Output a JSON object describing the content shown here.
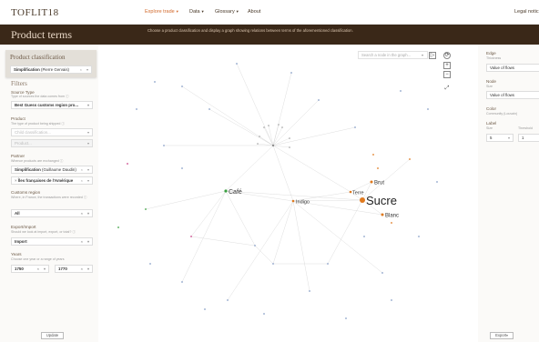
{
  "header": {
    "logo": "TOFLIT18",
    "nav": {
      "explore": "Explore trade",
      "data": "Data",
      "glossary": "Glossary",
      "about": "About",
      "legal": "Legal notic"
    }
  },
  "titlebar": {
    "title": "Product terms",
    "description": "Choose a product classification and display a graph showing relations between terms of the aforementioned classification."
  },
  "left_panel": {
    "product_classification": {
      "title": "Product classification",
      "value_bold": "Simplification",
      "value_rest": " (Pierre Gervais)"
    },
    "filters_title": "Filters",
    "source_type": {
      "label": "Source Type",
      "sub": "Type of sources the data comes from",
      "value": "Best Guess customs region pro..."
    },
    "product": {
      "label": "Product",
      "sub": "The type of product being shipped",
      "placeholder_classification": "Child classification...",
      "placeholder_product": "Product..."
    },
    "partner": {
      "label": "Partner",
      "sub": "Whence products are exchanged",
      "value_bold": "Simplification",
      "value_rest": " (Guillaume Daudin)",
      "tag": "Îles françaises de l'Amérique"
    },
    "customs_region": {
      "label": "Customs region",
      "sub": "Where, in France, the transactions were recorded",
      "value": "All"
    },
    "export_import": {
      "label": "Export/Import",
      "sub": "Should we look at import, export, or total?",
      "value": "Import"
    },
    "years": {
      "label": "Years",
      "sub": "Choose one year or a range of years",
      "from": "1750",
      "to": "1770"
    },
    "update_label": "Update"
  },
  "graph": {
    "search_placeholder": "Search a node in the graph...",
    "controls": {
      "zoom_in": "+",
      "zoom_out": "−"
    },
    "labels": {
      "cafe": "Café",
      "indigo": "Indigo",
      "terre": "Terre",
      "brut": "Brut",
      "sucre": "Sucre",
      "blanc": "Blanc"
    },
    "colors": {
      "orange": "#e07a1f",
      "green": "#3aa040",
      "dark": "#555555"
    }
  },
  "right_panel": {
    "edge": {
      "label": "Edge",
      "sub": "Thickness",
      "value": "Value of flows"
    },
    "node": {
      "label": "Node",
      "sub": "Size",
      "value": "Value of flows"
    },
    "color": {
      "label": "Color",
      "sub": "Community (Louvain)"
    },
    "label": {
      "label": "Label",
      "size_sub": "Size",
      "threshold_sub": "Threshold",
      "size_value": "5",
      "threshold_value": "1"
    },
    "export_label": "Export"
  }
}
